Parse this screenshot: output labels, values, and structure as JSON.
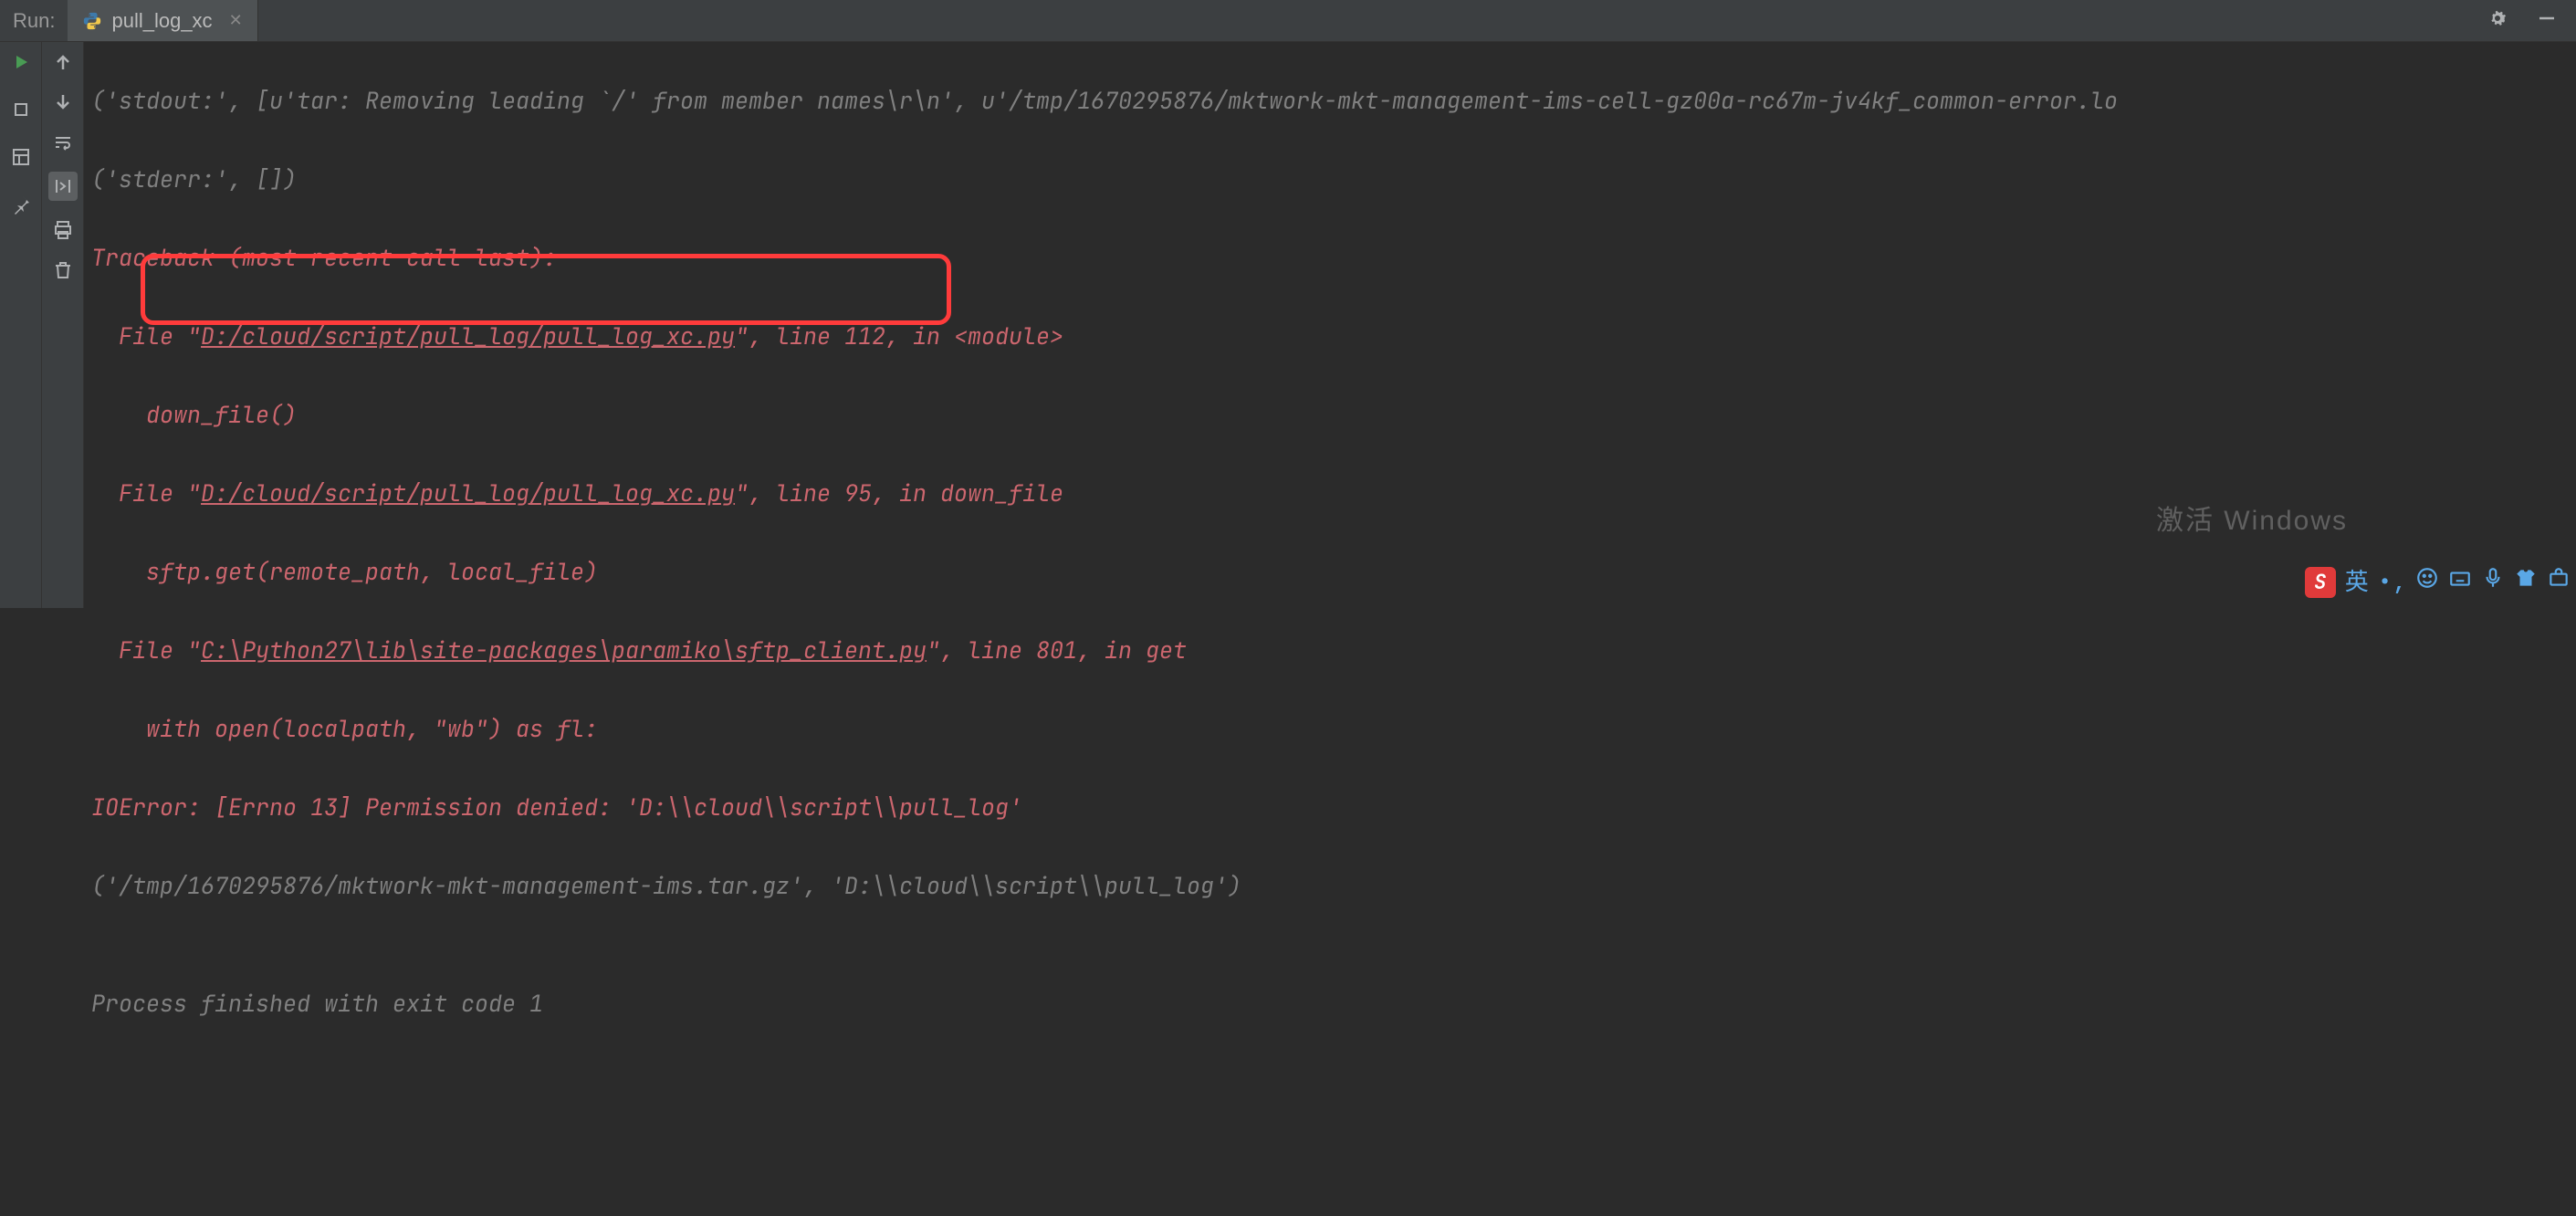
{
  "topbar": {
    "run_label": "Run:",
    "tab_name": "pull_log_xc"
  },
  "console": {
    "l1": "('stdout:', [u'tar: Removing leading `/' from member names\\r\\n', u'/tmp/1670295876/mktwork-mkt-management-ims-cell-gz00a-rc67m-jv4kf_common-error.lo",
    "l2": "('stderr:', [])",
    "l3": "Traceback (most recent call last):",
    "l4a": "  File \"",
    "l4b": "D:/cloud/script/pull_log/pull_log_xc.py",
    "l4c": "\", line 112, in <module>",
    "l5": "    down_file()",
    "l6a": "  File \"",
    "l6b": "D:/cloud/script/pull_log/pull_log_xc.py",
    "l6c": "\", line 95, in down_file",
    "l7": "    sftp.get(remote_path, local_file)",
    "l8a": "  File \"",
    "l8b": "C:\\Python27\\lib\\site-packages\\paramiko\\sftp_client.py",
    "l8c": "\", line 801, in get",
    "l9": "    with open(localpath, \"wb\") as fl:",
    "l10": "IOError: [Errno 13] Permission denied: 'D:\\\\cloud\\\\script\\\\pull_log'",
    "l11": "('/tmp/1670295876/mktwork-mkt-management-ims.tar.gz', 'D:\\\\cloud\\\\script\\\\pull_log')",
    "l12": "",
    "l13": "Process finished with exit code 1"
  },
  "watermark": {
    "line1": "激活 Windows"
  },
  "ime": {
    "logo": "S",
    "lang": "英",
    "punct": "•,"
  }
}
